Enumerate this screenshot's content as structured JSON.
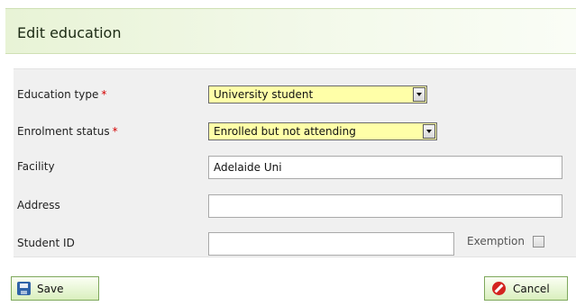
{
  "dialog": {
    "title": "Edit education"
  },
  "form": {
    "education_type": {
      "label": "Education type",
      "required_mark": "*",
      "value": "University student"
    },
    "enrolment_status": {
      "label": "Enrolment status",
      "required_mark": "*",
      "value": "Enrolled but not attending"
    },
    "facility": {
      "label": "Facility",
      "value": "Adelaide Uni"
    },
    "address": {
      "label": "Address",
      "value": ""
    },
    "student_id": {
      "label": "Student ID",
      "value": ""
    },
    "exemption": {
      "label": "Exemption",
      "checked": false
    }
  },
  "buttons": {
    "save_label": "Save",
    "cancel_label": "Cancel"
  },
  "icons": {
    "save": "floppy-disk-icon",
    "cancel": "no-entry-icon",
    "dropdown": "chevron-down-icon"
  },
  "colors": {
    "header_tint": "#e8f3d6",
    "required_star": "#d40000",
    "select_highlight": "#ffffa8",
    "button_border": "#7ea85c",
    "cancel_icon": "#d3241f",
    "save_icon": "#2f63a8"
  }
}
